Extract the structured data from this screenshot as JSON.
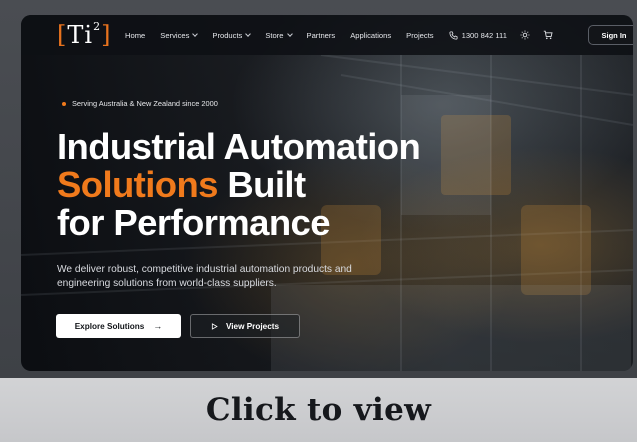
{
  "nav": {
    "logo_open": "[",
    "logo_text": "Ti",
    "logo_sup": "2",
    "logo_close": "]",
    "links": [
      "Home",
      "Services",
      "Products",
      "Store",
      "Partners",
      "Applications",
      "Projects"
    ],
    "phone": "1300 842 111",
    "sign_in": "Sign In"
  },
  "hero": {
    "badge": "Serving Australia & New Zealand since 2000",
    "headline_line1": "Industrial Automation",
    "headline_accent": "Solutions",
    "headline_line2_rest": " Built",
    "headline_line3": "for Performance",
    "description": "We deliver robust, competitive industrial automation products and engineering solutions from world-class suppliers.",
    "primary_button": "Explore Solutions",
    "primary_arrow": "→",
    "secondary_button": "View Projects"
  },
  "banner": {
    "text": "Click to view"
  },
  "colors": {
    "accent": "#f07a1c",
    "nav_bg": "#0e1014",
    "banner_bg": "#cfd0d2"
  },
  "icons": {
    "phone": "phone-icon",
    "theme": "sun-icon",
    "cart": "cart-icon",
    "play": "play-icon"
  }
}
